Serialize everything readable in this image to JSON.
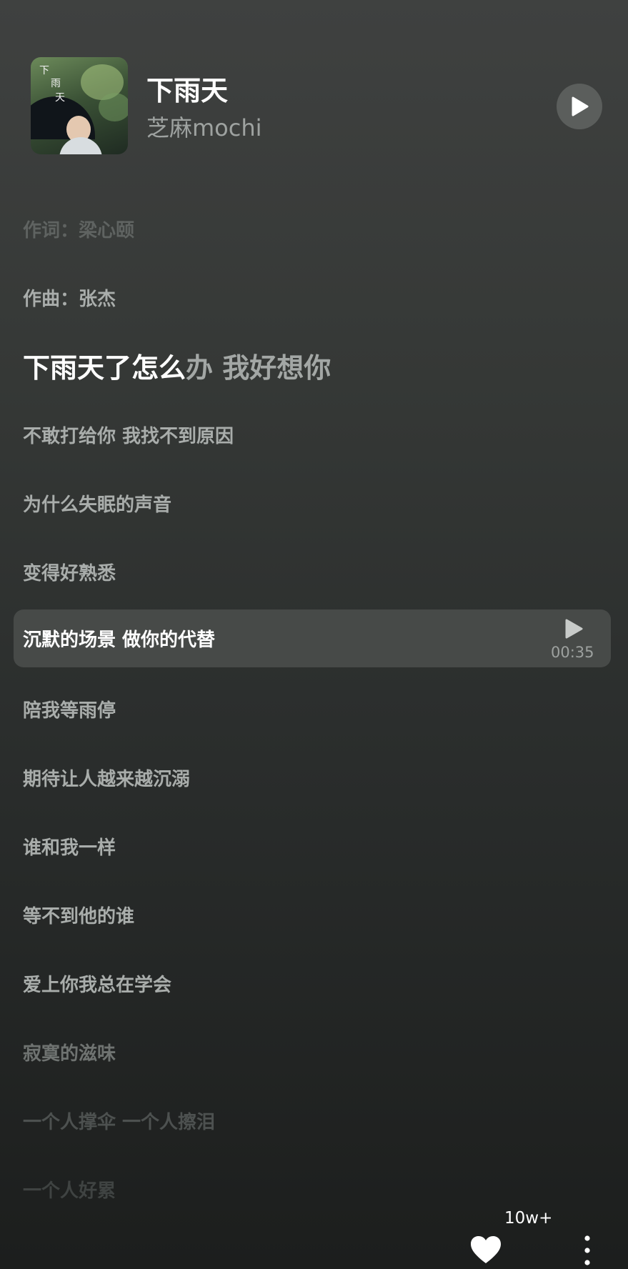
{
  "song": {
    "title": "下雨天",
    "artist": "芝麻mochi",
    "cover_text": [
      "下",
      "雨",
      "天"
    ]
  },
  "lyrics": {
    "lines": [
      {
        "text": "作词：梁心颐",
        "state": "faint"
      },
      {
        "text": "作曲：张杰",
        "state": "normal"
      },
      {
        "sung": "下雨天了怎么",
        "unsung": "办 我好想你",
        "state": "current"
      },
      {
        "text": "不敢打给你 我找不到原因",
        "state": "normal"
      },
      {
        "text": "为什么失眠的声音",
        "state": "normal"
      },
      {
        "text": "变得好熟悉",
        "state": "normal"
      },
      {
        "text": "沉默的场景 做你的代替",
        "state": "selected"
      },
      {
        "text": "陪我等雨停",
        "state": "normal"
      },
      {
        "text": "期待让人越来越沉溺",
        "state": "normal"
      },
      {
        "text": "谁和我一样",
        "state": "normal"
      },
      {
        "text": "等不到他的谁",
        "state": "normal"
      },
      {
        "text": "爱上你我总在学会",
        "state": "normal"
      },
      {
        "text": "寂寞的滋味",
        "state": "fade1"
      },
      {
        "text": "一个人撑伞 一个人擦泪",
        "state": "fade2"
      },
      {
        "text": "一个人好累",
        "state": "fade3"
      }
    ],
    "selected_time": "00:35"
  },
  "actions": {
    "like_count": "10w+"
  },
  "colors": {
    "background_top": "#3f4140",
    "background_bottom": "#1c1e1d",
    "highlight_bg": "#474a48",
    "play_button_bg": "#5b5e5c"
  },
  "icons": [
    "play-icon",
    "heart-icon",
    "more-vertical-icon"
  ]
}
